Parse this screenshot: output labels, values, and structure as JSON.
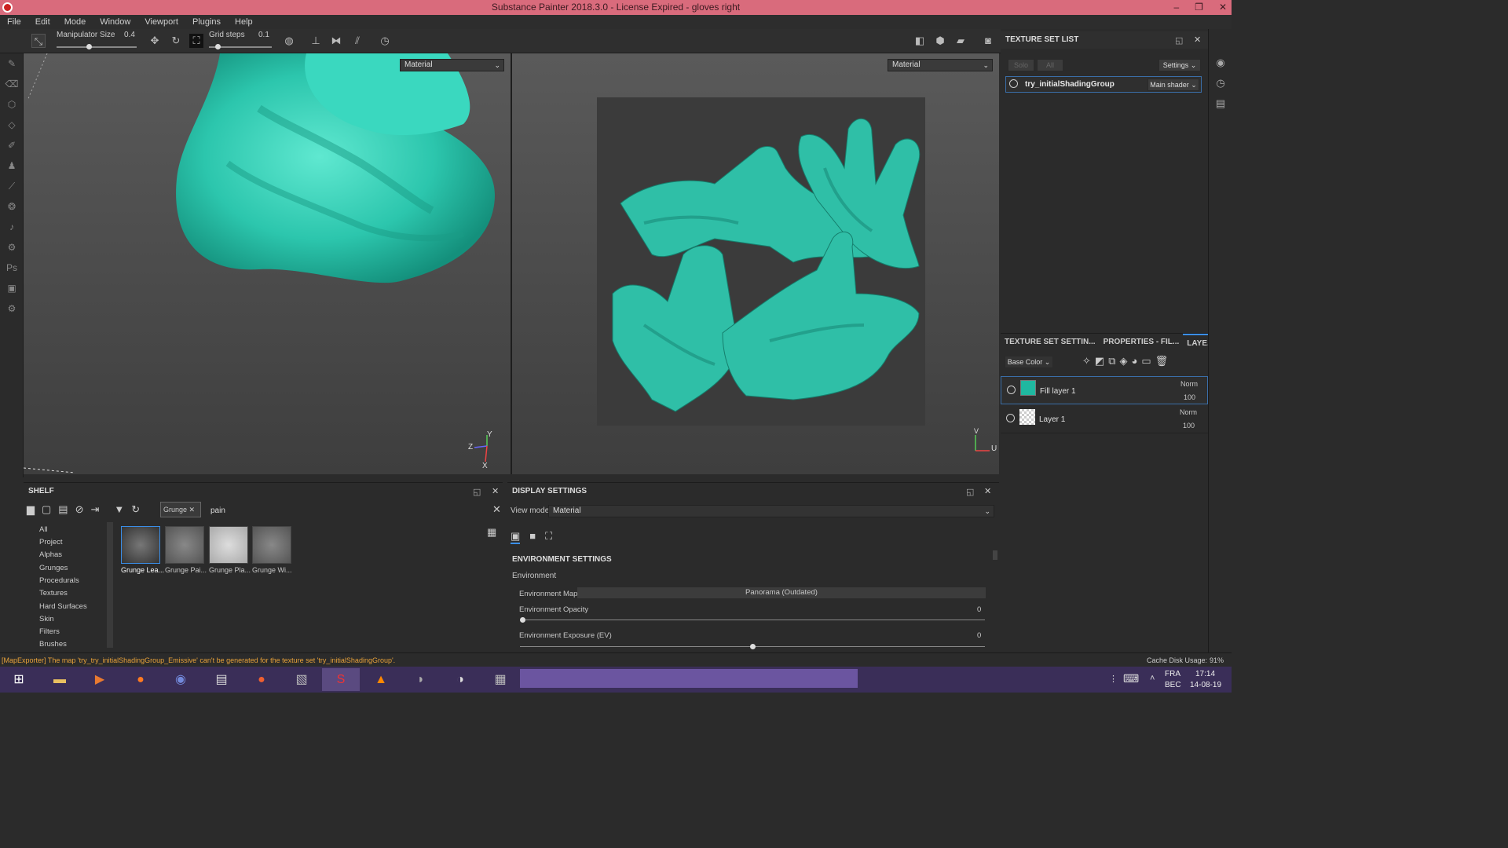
{
  "window": {
    "title": "Substance Painter 2018.3.0 - License Expired - gloves right",
    "minimize": "–",
    "restore": "❐",
    "close": "✕"
  },
  "menu": [
    "File",
    "Edit",
    "Mode",
    "Window",
    "Viewport",
    "Plugins",
    "Help"
  ],
  "toolbar": {
    "manipulator_label": "Manipulator Size",
    "manipulator_value": "0.4",
    "grid_label": "Grid steps",
    "grid_value": "0.1"
  },
  "viewport3d": {
    "mode": "Material",
    "axis_y": "Y",
    "axis_z": "Z",
    "axis_x": "X"
  },
  "viewport2d": {
    "mode": "Material",
    "axis_v": "V",
    "axis_u": "U"
  },
  "texture_set_list": {
    "title": "TEXTURE SET LIST",
    "solo": "Solo",
    "all": "All",
    "settings": "Settings",
    "set_name": "try_initialShadingGroup",
    "shader": "Main shader"
  },
  "layers_panel": {
    "tabs": [
      "TEXTURE SET SETTIN...",
      "PROPERTIES - FIL...",
      "LAYE..."
    ],
    "channel": "Base Color",
    "layers": [
      {
        "name": "Fill layer 1",
        "blend": "Norm",
        "opacity": "100",
        "swatch": "#1fb8a0"
      },
      {
        "name": "Layer 1",
        "blend": "Norm",
        "opacity": "100",
        "swatch": "checker"
      }
    ]
  },
  "shelf": {
    "title": "SHELF",
    "filter_tag": "Grunge",
    "search": "pain",
    "categories": [
      "All",
      "Project",
      "Alphas",
      "Grunges",
      "Procedurals",
      "Textures",
      "Hard Surfaces",
      "Skin",
      "Filters",
      "Brushes"
    ],
    "items": [
      "Grunge Lea...",
      "Grunge Pai...",
      "Grunge Pla...",
      "Grunge Wi..."
    ]
  },
  "display_settings": {
    "title": "DISPLAY SETTINGS",
    "view_mode_label": "View mode",
    "view_mode": "Material",
    "section": "ENVIRONMENT SETTINGS",
    "group": "Environment",
    "env_map_label": "Environment Map",
    "env_map_value": "Panorama (Outdated)",
    "opacity_label": "Environment Opacity",
    "opacity_value": "0",
    "exposure_label": "Environment Exposure (EV)",
    "exposure_value": "0"
  },
  "status": {
    "message": "[MapExporter] The map 'try_try_initialShadingGroup_Emissive' can't be generated for the texture set 'try_initialShadingGroup'.",
    "cache": "Cache Disk Usage:",
    "cache_value": "91%"
  },
  "taskbar": {
    "lang1": "FRA",
    "lang2": "BEC",
    "time": "17:14",
    "date": "14-08-19"
  },
  "colors": {
    "accent": "#1fb8a0",
    "title_bar": "#d96b7c",
    "taskbar": "#3a2e58"
  }
}
